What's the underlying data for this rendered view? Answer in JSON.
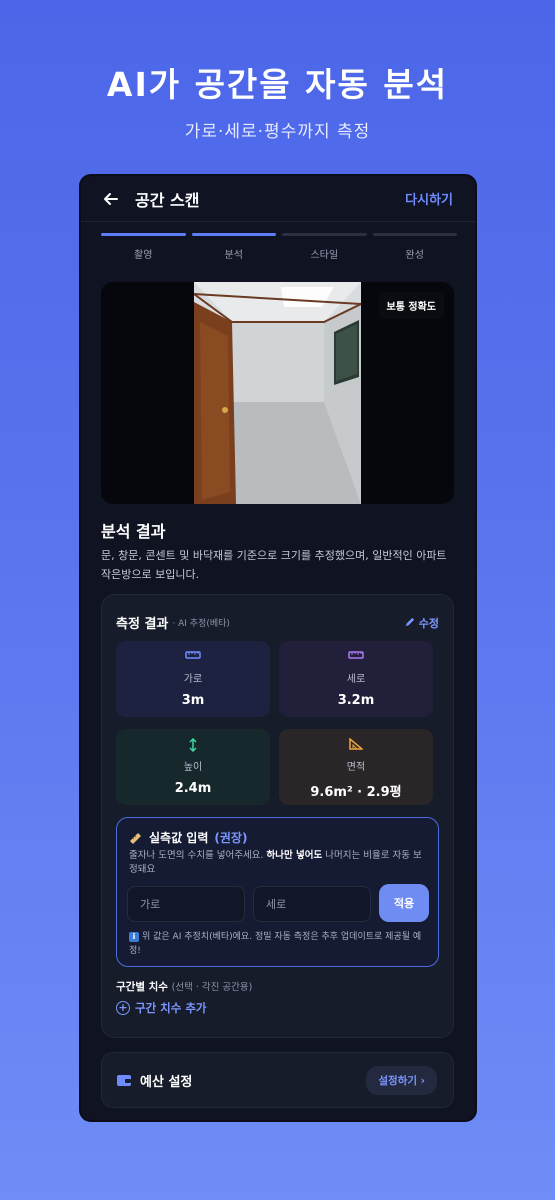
{
  "hero": {
    "title": "AI가 공간을 자동 분석",
    "subtitle": "가로·세로·평수까지 측정"
  },
  "appbar": {
    "title": "공간 스캔",
    "action": "다시하기"
  },
  "steps": [
    {
      "label": "촬영",
      "active": true
    },
    {
      "label": "분석",
      "active": true
    },
    {
      "label": "스타일",
      "active": false
    },
    {
      "label": "완성",
      "active": false
    }
  ],
  "photo": {
    "badge": "보통 정확도"
  },
  "analysis": {
    "title": "분석 결과",
    "description": "문, 창문, 콘센트 및 바닥재를 기준으로 크기를 추정했으며, 일반적인 아파트 작은방으로 보입니다."
  },
  "measure": {
    "title": "측정 결과",
    "tag": "· AI 추정(베타)",
    "edit_label": "수정",
    "width": {
      "label": "가로",
      "value": "3m"
    },
    "depth": {
      "label": "세로",
      "value": "3.2m"
    },
    "height": {
      "label": "높이",
      "value": "2.4m"
    },
    "area": {
      "label": "면적",
      "value": "9.6m² · 2.9평"
    }
  },
  "manual_input": {
    "title": "실측값 입력",
    "recommended": "(권장)",
    "desc_before": "줄자나 도면의 수치를 넣어주세요. ",
    "desc_bold": "하나만 넣어도",
    "desc_after": " 나머지는 비율로 자동 보정돼요",
    "width_placeholder": "가로",
    "depth_placeholder": "세로",
    "apply_label": "적용",
    "note": "위 값은 AI 추정치(베타)에요. 정밀 자동 측정은 추후 업데이트로 제공될 예정!"
  },
  "segment": {
    "label": "구간별 치수",
    "hint": "(선택 · 각진 공간용)",
    "add_label": "구간 치수 추가"
  },
  "budget": {
    "title": "예산 설정",
    "button": "설정하기 ›"
  },
  "colors": {
    "accent": "#5e7ef5",
    "link": "#7c96ff",
    "background": "#0f1322"
  },
  "icons": [
    "back-arrow-icon",
    "ruler-icon",
    "height-arrows-icon",
    "triangle-ruler-icon",
    "pencil-icon",
    "info-icon",
    "plus-circle-icon",
    "wallet-icon"
  ]
}
